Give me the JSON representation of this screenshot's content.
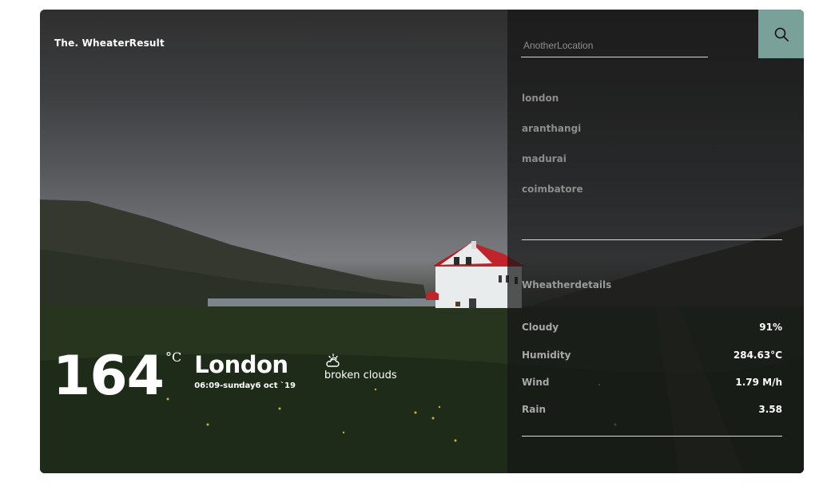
{
  "app": {
    "brand": "The. WheaterResult"
  },
  "current": {
    "temperature": "164",
    "unit": "°C",
    "city": "London",
    "datetime": "06:09-sunday6 oct `19",
    "condition": "broken clouds",
    "condition_icon": "cloudy-sun-icon"
  },
  "search": {
    "placeholder": "AnotherLocation",
    "icon": "search-icon"
  },
  "locations": [
    "london",
    "aranthangi",
    "madurai",
    "coimbatore"
  ],
  "details": {
    "title": "Wheatherdetails",
    "rows": [
      {
        "label": "Cloudy",
        "value": "91%"
      },
      {
        "label": "Humidity",
        "value": "284.63°C"
      },
      {
        "label": "Wind",
        "value": "1.79 M/h"
      },
      {
        "label": "Rain",
        "value": "3.58"
      }
    ]
  },
  "colors": {
    "accent": "#7aa09a",
    "panel": "#161616",
    "text": "#ffffff"
  }
}
